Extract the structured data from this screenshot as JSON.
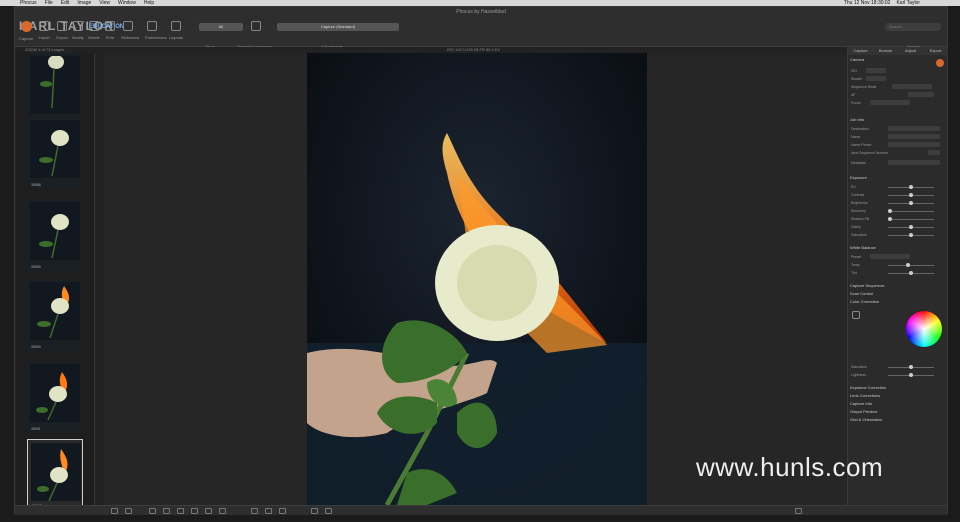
{
  "menubar": {
    "items": [
      "Phocus",
      "File",
      "Edit",
      "Image",
      "View",
      "Window",
      "Help"
    ],
    "clock": "Thu 12 Nov 18:30:02",
    "user": "Karl Taylor"
  },
  "window_title": "Phocus by Hasselblad",
  "brand": {
    "name": "KARL TAYLOR",
    "sub": "EDUCATION"
  },
  "toolbar": {
    "tools": [
      "Capture",
      "Import",
      "Export",
      "Modify",
      "Delete",
      "Print",
      "Slideshow",
      "Preferences",
      "Layouts"
    ],
    "show_field": "All",
    "show_label": "Show",
    "picture_label": "Pictures/Landscape",
    "adjustments_field": "Capture (Standard)",
    "adjustments_label": "Adjustments",
    "search_placeholder": "Search",
    "search_label": "Search"
  },
  "infobar": {
    "left": "ZOOM   1 of 73 images",
    "center": "ISO 100  1/125  f/8  FR 80  0 EV"
  },
  "browser": {
    "thumbnails": [
      {
        "name": "35587"
      },
      {
        "name": "35588"
      },
      {
        "name": "35589"
      },
      {
        "name": "35590"
      },
      {
        "name": "35591"
      },
      {
        "name": "35592"
      }
    ]
  },
  "panel": {
    "tabs": [
      "Capture",
      "Browse",
      "Adjust",
      "Export"
    ],
    "sections": {
      "camera": "Camera",
      "camera_rows": [
        "ISO",
        "Shutter",
        "Sequence Mode",
        "AF",
        "Focus"
      ],
      "job_info": "Job Info",
      "job_rows": [
        "Destination",
        "Name",
        "Name Preset",
        "Next Sequence Number",
        "Metadata"
      ],
      "exposure": "Exposure",
      "exposure_rows": [
        "EV",
        "Contrast",
        "Brightness",
        "Recovery",
        "Shadow Fill",
        "Clarity",
        "Saturation"
      ],
      "white_balance": "White Balance",
      "wb_rows": [
        "Preset",
        "Temp",
        "Tint"
      ],
      "capture_sequencer": "Capture Sequencer",
      "scan_control": "Scan Control",
      "color_correction": "Color Correction",
      "cc_rows": [
        "Saturation",
        "Lightness"
      ],
      "bottom_tools": [
        "Keystone Correction",
        "Lens Corrections",
        "Capture Info",
        "Output Preview",
        "Grid & Orientation"
      ]
    }
  },
  "watermark": "www.hunls.com"
}
